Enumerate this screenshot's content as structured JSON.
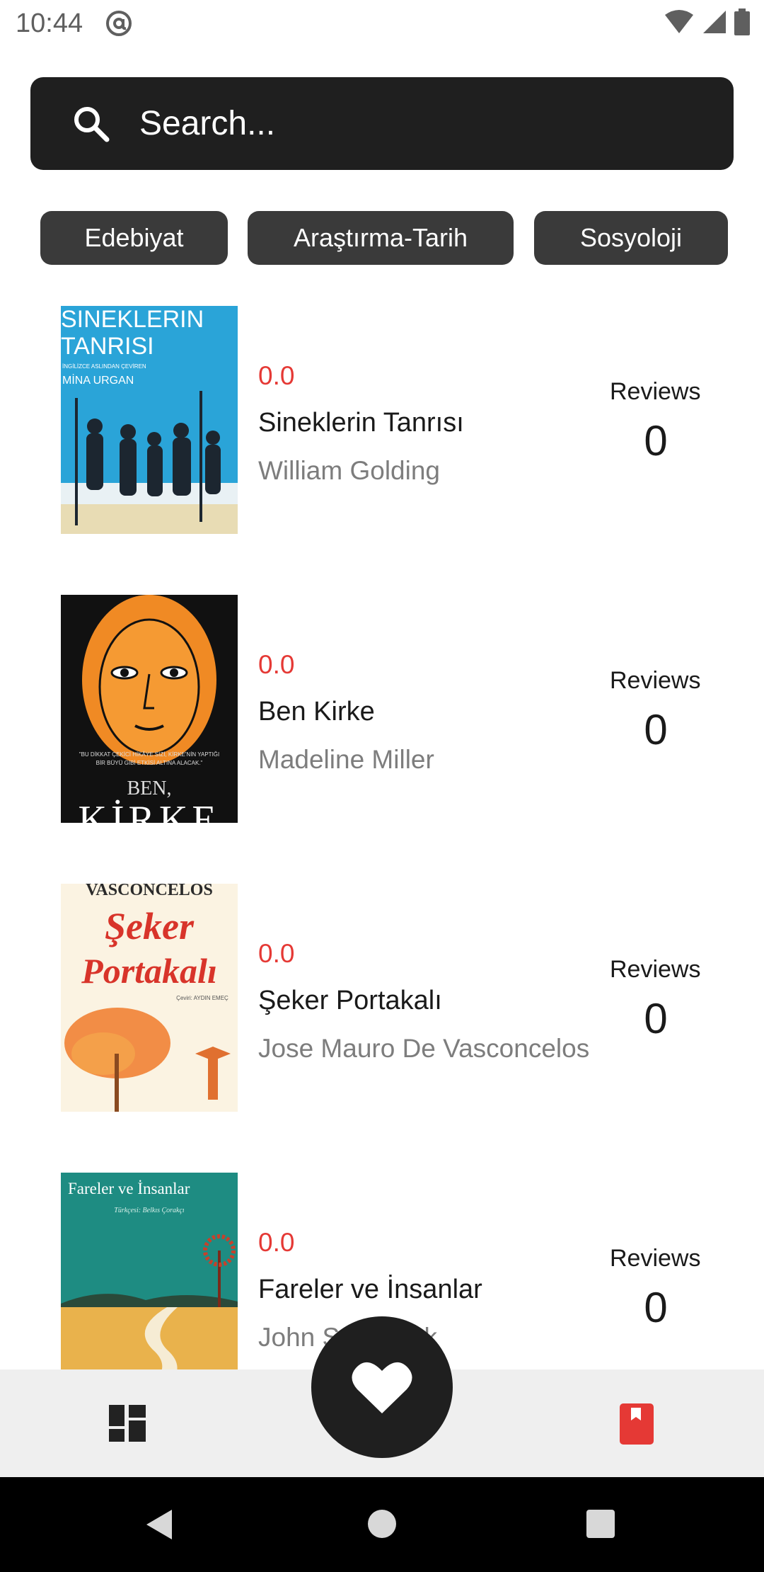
{
  "status_bar": {
    "time": "10:44"
  },
  "search": {
    "placeholder": "Search..."
  },
  "categories": [
    "Edebiyat",
    "Araştırma-Tarih",
    "Sosyoloji"
  ],
  "reviews_label": "Reviews",
  "books": [
    {
      "rating": "0.0",
      "title": "Sineklerin Tanrısı",
      "author": "William Golding",
      "reviews": "0",
      "cover_text": [
        "SINEKLERIN",
        "TANRISI",
        "İNGİLİZCE ASLINDAN ÇEVİREN",
        "MİNA URGAN"
      ]
    },
    {
      "rating": "0.0",
      "title": "Ben Kirke",
      "author": "Madeline Miller",
      "reviews": "0",
      "cover_text": [
        "\"BU DİKKAT ÇEKİCİ HİKÂYE SİZİ, KİRKE'NİN YAPTIĞI",
        "BİR BÜYÜ GİBİ ETKİSİ ALTINA ALACAK.\"",
        "BEN,",
        "KİRKE"
      ]
    },
    {
      "rating": "0.0",
      "title": "Şeker Portakalı",
      "author": "Jose Mauro De Vasconcelos",
      "reviews": "0",
      "cover_text": [
        "VASCONCELOS",
        "Şeker",
        "Portakalı",
        "Çeviri: AYDIN EMEÇ"
      ]
    },
    {
      "rating": "0.0",
      "title": "Fareler ve İnsanlar",
      "author": "John Steinbeck",
      "reviews": "0",
      "cover_text": [
        "Fareler ve İnsanlar",
        "Türkçesi: Belkıs Çorakçı"
      ]
    }
  ],
  "colors": {
    "accent": "#e53935",
    "dark": "#1f1f1f",
    "chip": "#3a3a3a"
  },
  "icons": {
    "search": "search-icon",
    "fab": "heart-icon",
    "nav_left": "dashboard-icon",
    "nav_right": "bookmark-icon"
  }
}
